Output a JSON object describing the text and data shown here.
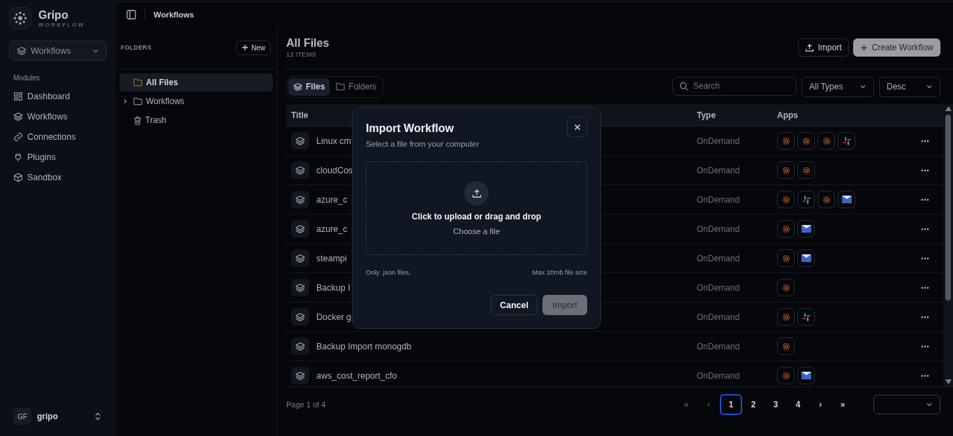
{
  "brand": {
    "name": "Gripo",
    "tagline": "WORKFLOW"
  },
  "module_select": {
    "value": "Workflows"
  },
  "sidebar": {
    "heading": "Modules",
    "items": [
      {
        "label": "Dashboard"
      },
      {
        "label": "Workflows"
      },
      {
        "label": "Connections"
      },
      {
        "label": "Plugins"
      },
      {
        "label": "Sandbox"
      }
    ]
  },
  "user": {
    "initials": "GF",
    "name": "gripo"
  },
  "breadcrumb": "Workflows",
  "folders": {
    "heading": "FOLDERS",
    "new_button": "New",
    "items": [
      {
        "label": "All Files",
        "selected": true,
        "kind": "folder",
        "expandable": false
      },
      {
        "label": "Workflows",
        "selected": false,
        "kind": "folder",
        "expandable": true
      },
      {
        "label": "Trash",
        "selected": false,
        "kind": "trash",
        "expandable": false
      }
    ]
  },
  "header": {
    "title": "All Files",
    "count": "12 ITEMS",
    "import_button": "Import",
    "create_button": "Create Workflow"
  },
  "view_tabs": [
    {
      "label": "Files",
      "selected": true
    },
    {
      "label": "Folders",
      "selected": false
    }
  ],
  "search": {
    "placeholder": "Search"
  },
  "type_filter": {
    "value": "All Types"
  },
  "sort_select": {
    "value": "Desc"
  },
  "table": {
    "columns": [
      "Title",
      "Type",
      "Apps"
    ],
    "rows": [
      {
        "title": "Linux cm",
        "type": "OnDemand",
        "apps": [
          {
            "kind": "gear"
          },
          {
            "kind": "gear"
          },
          {
            "kind": "gear"
          },
          {
            "kind": "slack"
          }
        ]
      },
      {
        "title": "cloudCos",
        "type": "OnDemand",
        "apps": [
          {
            "kind": "gear"
          },
          {
            "kind": "gear"
          }
        ]
      },
      {
        "title": "azure_c",
        "type": "OnDemand",
        "apps": [
          {
            "kind": "gear"
          },
          {
            "kind": "slack"
          },
          {
            "kind": "gear"
          },
          {
            "kind": "mail"
          }
        ]
      },
      {
        "title": "azure_c",
        "type": "OnDemand",
        "apps": [
          {
            "kind": "gear"
          },
          {
            "kind": "mail"
          }
        ]
      },
      {
        "title": "steampi",
        "type": "OnDemand",
        "apps": [
          {
            "kind": "gear"
          },
          {
            "kind": "mail"
          }
        ]
      },
      {
        "title": "Backup I",
        "type": "OnDemand",
        "apps": [
          {
            "kind": "gear"
          }
        ]
      },
      {
        "title": "Docker g",
        "type": "OnDemand",
        "apps": [
          {
            "kind": "gear"
          },
          {
            "kind": "slack"
          }
        ]
      },
      {
        "title": "Backup Import monogdb",
        "type": "OnDemand",
        "apps": [
          {
            "kind": "gear"
          }
        ]
      },
      {
        "title": "aws_cost_report_cfo",
        "type": "OnDemand",
        "apps": [
          {
            "kind": "gear"
          },
          {
            "kind": "mail"
          }
        ]
      }
    ]
  },
  "pagination": {
    "summary": "Page 1 of 4",
    "first": "«",
    "prev": "‹",
    "next": "›",
    "last": "»",
    "pages": [
      {
        "label": "1",
        "selected": true
      },
      {
        "label": "2",
        "selected": false
      },
      {
        "label": "3",
        "selected": false
      },
      {
        "label": "4",
        "selected": false
      }
    ]
  },
  "dialog": {
    "title": "Import Workflow",
    "subtitle": "Select a file from your computer",
    "drop_title": "Click to upload or drag and drop",
    "drop_hint": "Choose a file",
    "note_left": "Only .json files.",
    "note_right": "Max 20mb file size",
    "cancel": "Cancel",
    "confirm": "Import",
    "confirm_disabled": true
  }
}
